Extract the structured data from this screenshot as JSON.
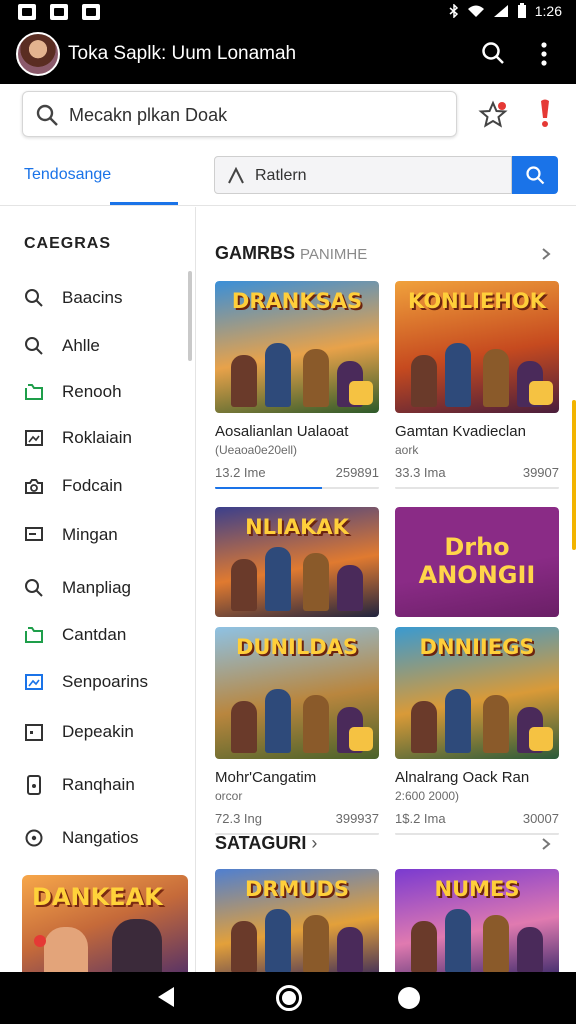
{
  "status_bar": {
    "time": "1:26"
  },
  "app_bar": {
    "title": "Toka Saplk: Uum Lonamah"
  },
  "search": {
    "text": "Mecakn plkan Doak"
  },
  "tabs": {
    "active_label": "Tendosange"
  },
  "filter": {
    "text": "Ratlern"
  },
  "sidebar": {
    "heading": "CAEGRAS",
    "items": [
      {
        "label": "Baacins",
        "icon": "search-icon",
        "color": "#333333"
      },
      {
        "label": "Ahlle",
        "icon": "search-icon",
        "color": "#333333"
      },
      {
        "label": "Renooh",
        "icon": "folder-icon",
        "color": "#1e9e4a"
      },
      {
        "label": "Roklaiain",
        "icon": "image-icon",
        "color": "#333333"
      },
      {
        "label": "Fodcain",
        "icon": "camera-icon",
        "color": "#333333"
      },
      {
        "label": "Mingan",
        "icon": "monitor-icon",
        "color": "#333333"
      },
      {
        "label": "Manpliag",
        "icon": "search-icon",
        "color": "#333333"
      },
      {
        "label": "Cantdan",
        "icon": "folder-icon",
        "color": "#1e9e4a"
      },
      {
        "label": "Senpoarins",
        "icon": "image-icon",
        "color": "#1a73e8"
      },
      {
        "label": "Depeakin",
        "icon": "calendar-icon",
        "color": "#333333"
      },
      {
        "label": "Ranqhain",
        "icon": "phone-icon",
        "color": "#333333"
      },
      {
        "label": "Nangatios",
        "icon": "location-icon",
        "color": "#333333"
      }
    ],
    "banner_text": "DANKEAK"
  },
  "sections": [
    {
      "title": "GAMRBS",
      "subtitle": "PANIMHE"
    },
    {
      "title": "SATAGURI",
      "subtitle": ""
    }
  ],
  "tiles": [
    {
      "art": "DRANKSAS",
      "title": "Aosalianlan Ualaoat",
      "meta": "(Ueaoa0e20ell)",
      "size": "13.2 Ime",
      "count": "259891",
      "progress": 0.65,
      "colors": [
        "#3a8fd8",
        "#e8a24a",
        "#2d5a2a"
      ]
    },
    {
      "art": "KONLIEHOK",
      "title": "Gamtan Kvadieclan",
      "meta": "aork",
      "size": "33.3 Ima",
      "count": "39907",
      "progress": 0,
      "colors": [
        "#f0a13c",
        "#c64a1f",
        "#4a1e3c"
      ]
    },
    {
      "art": "NLIAKAK",
      "title": "",
      "meta": "",
      "size": "",
      "count": "",
      "progress": 0,
      "colors": [
        "#3b3f8c",
        "#e07a30",
        "#21243f"
      ]
    },
    {
      "art": "Drho ANONGII",
      "title": "",
      "meta": "",
      "size": "",
      "count": "",
      "progress": 0,
      "colors": [
        "#8a2b86",
        "#8a2b86",
        "#6a1f66"
      ]
    },
    {
      "art": "DUNILDAS",
      "title": "Mohr'Cangatim",
      "meta": "orcor",
      "size": "72.3 Ing",
      "count": "399937",
      "progress": 0,
      "colors": [
        "#8ec2e4",
        "#b9863e",
        "#49622a"
      ]
    },
    {
      "art": "DNNIIEGS",
      "title": "Alnalrang Oack Ran",
      "meta": "2:600 2000)",
      "size": "1$.2 Ima",
      "count": "30007",
      "progress": 0,
      "colors": [
        "#3a9ad0",
        "#d99a38",
        "#2a5a3a"
      ]
    },
    {
      "art": "DRMUDS",
      "title": "",
      "meta": "",
      "size": "",
      "count": "",
      "progress": 0,
      "colors": [
        "#4f7fd0",
        "#e3a03a",
        "#3a2a5a"
      ]
    },
    {
      "art": "NUMES",
      "title": "",
      "meta": "",
      "size": "",
      "count": "",
      "progress": 0,
      "colors": [
        "#7a3ad0",
        "#e07ab0",
        "#3a2a6a"
      ]
    }
  ]
}
